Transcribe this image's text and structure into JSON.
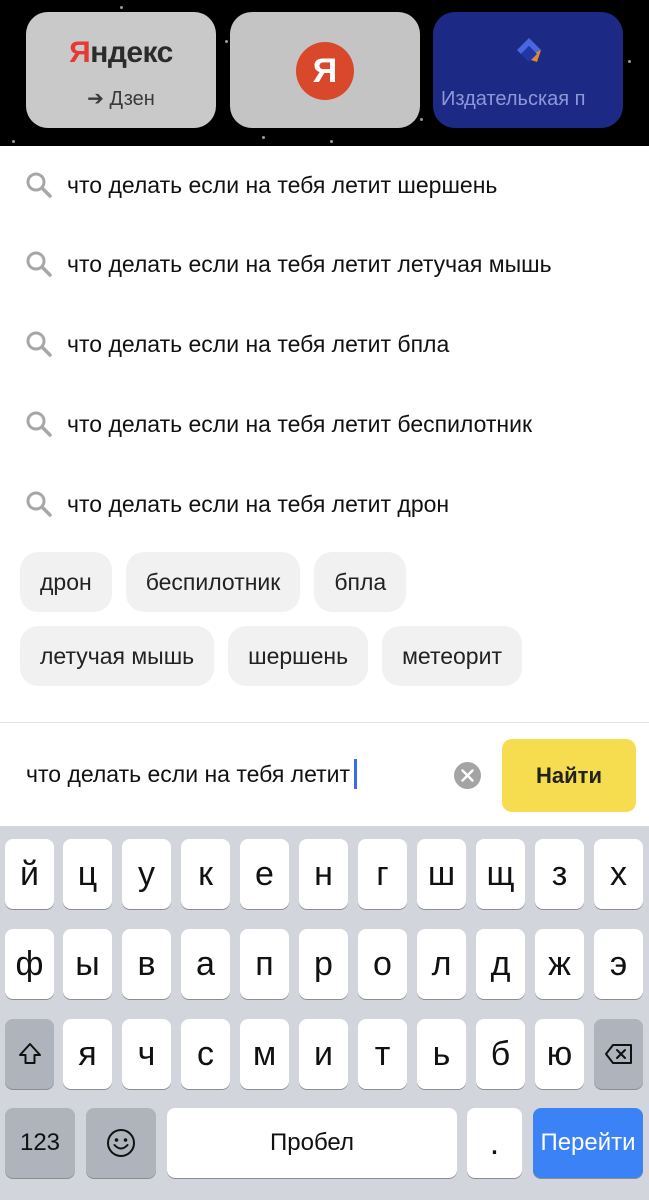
{
  "tiles": [
    {
      "name": "Яндекс",
      "sub": "➔ Дзен"
    },
    {
      "name": "Я"
    },
    {
      "name": "Издательская п"
    }
  ],
  "suggestions": [
    "что делать если на тебя летит шершень",
    "что делать если на тебя летит летучая мышь",
    "что делать если на тебя летит бпла",
    "что делать если на тебя летит беспилотник",
    "что делать если на тебя летит дрон"
  ],
  "chips": {
    "row1": [
      "дрон",
      "беспилотник",
      "бпла"
    ],
    "row2": [
      "летучая мышь",
      "шершень",
      "метеорит"
    ]
  },
  "search": {
    "value": "что делать если на тебя летит",
    "find_label": "Найти"
  },
  "keyboard": {
    "row1": [
      "й",
      "ц",
      "у",
      "к",
      "е",
      "н",
      "г",
      "ш",
      "щ",
      "з",
      "х"
    ],
    "row2": [
      "ф",
      "ы",
      "в",
      "а",
      "п",
      "р",
      "о",
      "л",
      "д",
      "ж",
      "э"
    ],
    "row3": [
      "я",
      "ч",
      "с",
      "м",
      "и",
      "т",
      "ь",
      "б",
      "ю"
    ],
    "numbers_label": "123",
    "space_label": "Пробел",
    "period_label": ".",
    "go_label": "Перейти"
  },
  "colors": {
    "find_button": "#f5dd4f",
    "go_button": "#3a82f6",
    "caret": "#3b6ce6",
    "yandex_red": "#e53935"
  }
}
